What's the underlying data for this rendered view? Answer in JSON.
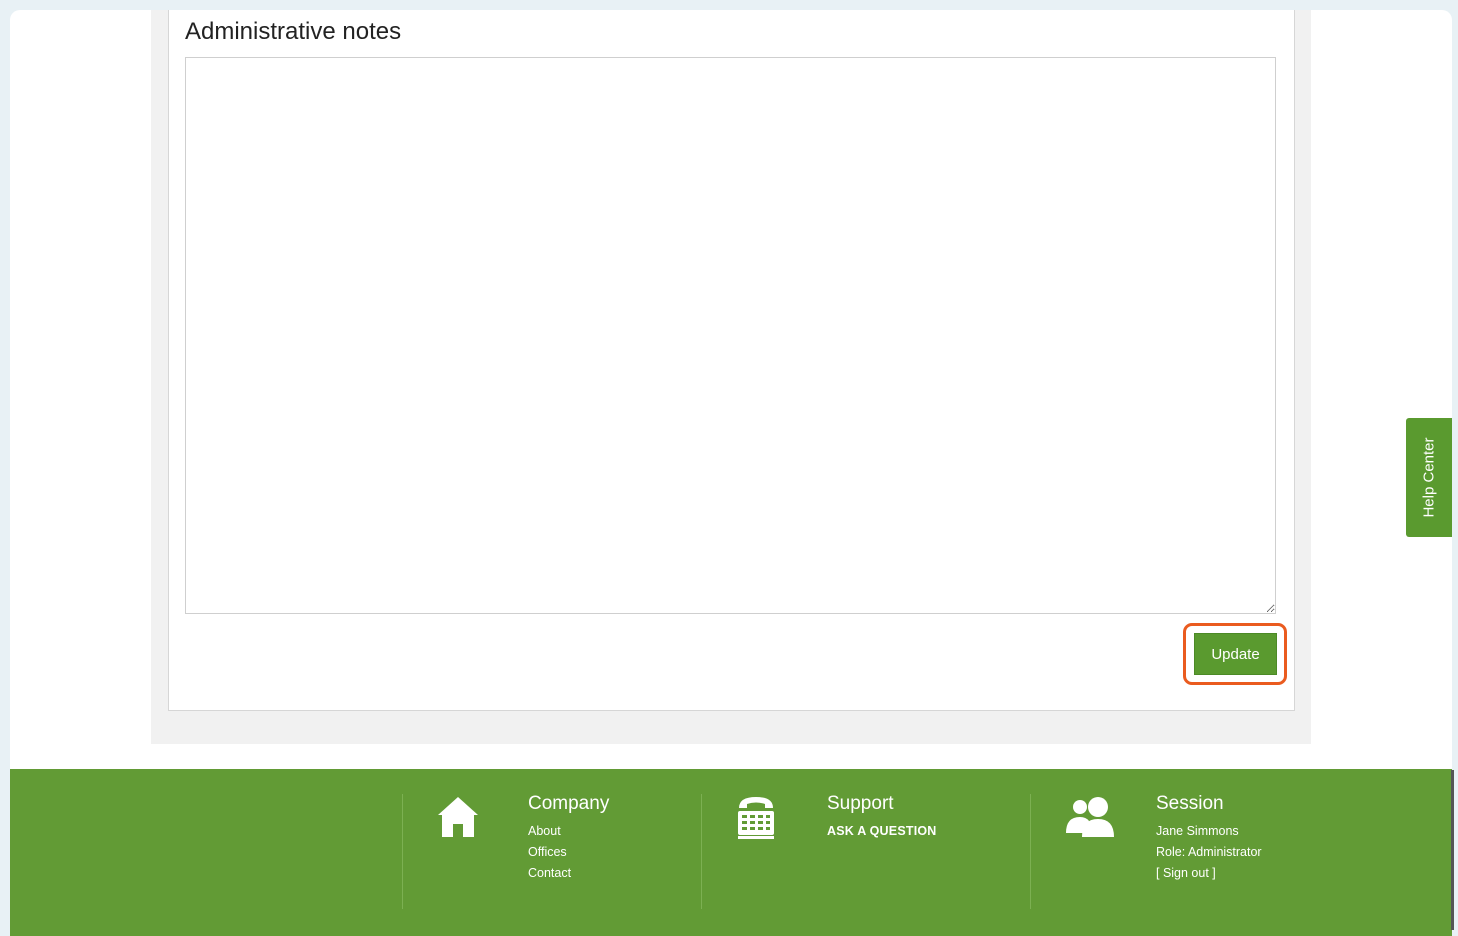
{
  "notes": {
    "title": "Administrative notes",
    "value": "",
    "update_label": "Update"
  },
  "help_tab": {
    "label": "Help Center"
  },
  "footer": {
    "company": {
      "title": "Company",
      "links": [
        "About",
        "Offices",
        "Contact"
      ],
      "icon": "home-icon"
    },
    "support": {
      "title": "Support",
      "links": [
        "ASK A QUESTION"
      ],
      "icon": "phone-icon"
    },
    "session": {
      "title": "Session",
      "user": "Jane Simmons",
      "role": "Role: Administrator",
      "sign_out": "[ Sign out ]",
      "icon": "users-icon"
    }
  },
  "colors": {
    "accent_green": "#629b35",
    "button_green": "#5a9a2f",
    "highlight_orange": "#ea5b1f"
  }
}
